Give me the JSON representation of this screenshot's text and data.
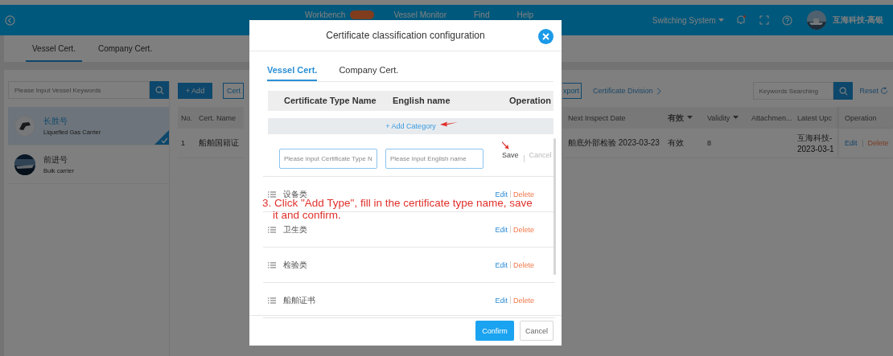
{
  "header": {
    "nav": [
      {
        "label": "Workbench",
        "badge": true
      },
      {
        "label": "Vessel Monitor",
        "badge": false
      },
      {
        "label": "Find",
        "badge": false
      },
      {
        "label": "Help",
        "badge": false
      }
    ],
    "system": "Switching System",
    "user": "互海科技-高银"
  },
  "tabs": [
    {
      "label": "Vessel Cert.",
      "selected": true
    },
    {
      "label": "Company Cert.",
      "selected": false
    }
  ],
  "vessel_search": {
    "placeholder": "Please Input Vessel Keywords"
  },
  "vessels": [
    {
      "name": "长胜号",
      "type": "Liquefied Gas Carrier",
      "kind": "icon",
      "selected": true
    },
    {
      "name": "前进号",
      "type": "Bulk carrier",
      "selected": false
    }
  ],
  "toolbar": {
    "add": "+ Add",
    "cert_button": "Cert",
    "export_button": "xport",
    "division_link": "Certificate Division",
    "keyword_search": {
      "placeholder": "Keywords Searching"
    },
    "reset": "Reset"
  },
  "table": {
    "columns_left": [
      "No.",
      "Cert. Name"
    ],
    "columns_right": [
      {
        "label": "Next Inspect Date",
        "filter": false
      },
      {
        "label": "有效",
        "filter": true
      },
      {
        "label": "Validity",
        "filter": true
      },
      {
        "label": "Attachmen...",
        "filter": false
      },
      {
        "label": "Latest Upc",
        "filter": false
      },
      {
        "label": "Operation",
        "filter": false
      }
    ],
    "rows": [
      {
        "no": "1",
        "cert_name": "船舶国籍证",
        "inspect": "舶底外部检验 2023-03-23",
        "status": "有效",
        "validity": "8",
        "updated_by": "互海科技-",
        "updated_at": "2023-03-1",
        "actions": [
          "Edit",
          "Delete"
        ]
      }
    ]
  },
  "modal": {
    "title": "Certificate classification configuration",
    "tabs": [
      {
        "label": "Vessel Cert.",
        "selected": true
      },
      {
        "label": "Company Cert.",
        "selected": false
      }
    ],
    "columns": [
      "Certificate Type Name",
      "English name",
      "Operation"
    ],
    "add_category": "+ Add Category",
    "new_row": {
      "name_placeholder": "Please input Certificate Type N",
      "english_placeholder": "Please input English name",
      "save": "Save",
      "cancel": "Cancel"
    },
    "categories": [
      {
        "name": "设备类",
        "actions": [
          "Edit",
          "Delete"
        ]
      },
      {
        "name": "卫生类",
        "actions": [
          "Edit",
          "Delete"
        ]
      },
      {
        "name": "检验类",
        "actions": [
          "Edit",
          "Delete"
        ]
      },
      {
        "name": "船舶证书",
        "actions": [
          "Edit",
          "Delete"
        ]
      }
    ],
    "annotation": "3. Click \"Add Type\", fill in the certificate type name, save it and confirm.",
    "buttons": [
      "Confirm",
      "Cancel"
    ]
  }
}
